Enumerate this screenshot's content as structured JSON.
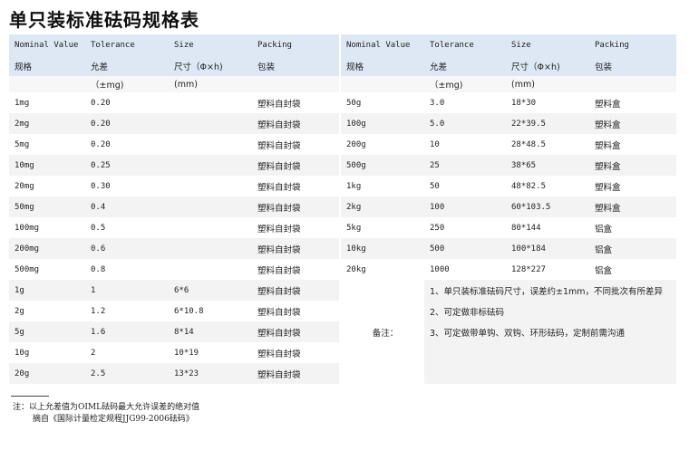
{
  "title": "单只装标准砝码规格表",
  "headers": {
    "en": [
      "Nominal Value",
      "Tolerance",
      "Size",
      "Packing"
    ],
    "zh": [
      "规格",
      "允差",
      "尺寸（Φ×h)",
      "包装"
    ],
    "units": [
      "",
      "（±mg)",
      "(mm)",
      ""
    ]
  },
  "left_rows": [
    [
      "1mg",
      "0.20",
      "",
      "塑料自封袋"
    ],
    [
      "2mg",
      "0.20",
      "",
      "塑料自封袋"
    ],
    [
      "5mg",
      "0.20",
      "",
      "塑料自封袋"
    ],
    [
      "10mg",
      "0.25",
      "",
      "塑料自封袋"
    ],
    [
      "20mg",
      "0.30",
      "",
      "塑料自封袋"
    ],
    [
      "50mg",
      "0.4",
      "",
      "塑料自封袋"
    ],
    [
      "100mg",
      "0.5",
      "",
      "塑料自封袋"
    ],
    [
      "200mg",
      "0.6",
      "",
      "塑料自封袋"
    ],
    [
      "500mg",
      "0.8",
      "",
      "塑料自封袋"
    ],
    [
      "1g",
      "1",
      "6*6",
      "塑料自封袋"
    ],
    [
      "2g",
      "1.2",
      "6*10.8",
      "塑料自封袋"
    ],
    [
      "5g",
      "1.6",
      "8*14",
      "塑料自封袋"
    ],
    [
      "10g",
      "2",
      "10*19",
      "塑料自封袋"
    ],
    [
      "20g",
      "2.5",
      "13*23",
      "塑料自封袋"
    ]
  ],
  "right_rows": [
    [
      "50g",
      "3.0",
      "18*30",
      "塑料盒"
    ],
    [
      "100g",
      "5.0",
      "22*39.5",
      "塑料盒"
    ],
    [
      "200g",
      "10",
      "28*48.5",
      "塑料盒"
    ],
    [
      "500g",
      "25",
      "38*65",
      "塑料盒"
    ],
    [
      "1kg",
      "50",
      "48*82.5",
      "塑料盒"
    ],
    [
      "2kg",
      "100",
      "60*103.5",
      "塑料盒"
    ],
    [
      "5kg",
      "250",
      "80*144",
      "铝盒"
    ],
    [
      "10kg",
      "500",
      "100*184",
      "铝盒"
    ],
    [
      "20kg",
      "1000",
      "128*227",
      "铝盒"
    ]
  ],
  "notes": {
    "label": "备注：",
    "items": [
      "1、单只装标准砝码尺寸，误差约±1mm，不同批次有所差异",
      "2、可定做非标砝码",
      "3、可定做带单钩、双钩、环形砝码，定制前需沟通"
    ]
  },
  "footnote": {
    "line1": "注：以上允差值为OIML砝码最大允许误差的绝对值",
    "line2": "摘自《国际计量检定规程JJG99-2006砝码》"
  }
}
